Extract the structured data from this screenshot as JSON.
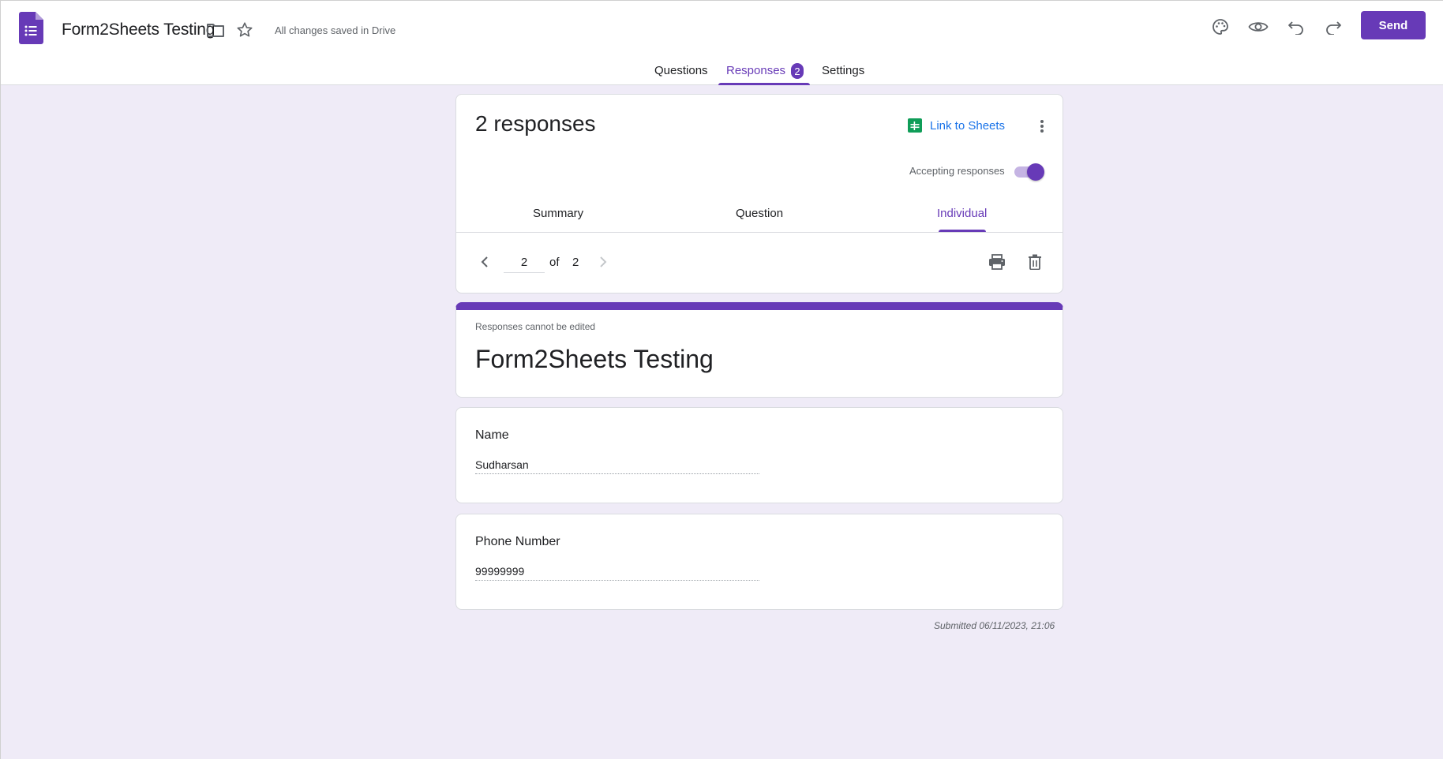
{
  "header": {
    "doc_title": "Form2Sheets Testing",
    "save_status": "All changes saved in Drive",
    "send_label": "Send",
    "icons": [
      "forms-logo-icon",
      "folder-icon",
      "star-icon",
      "palette-icon",
      "preview-eye-icon",
      "undo-icon",
      "redo-icon"
    ]
  },
  "tabs": {
    "questions": "Questions",
    "responses": "Responses",
    "responses_count": "2",
    "settings": "Settings",
    "active": "Responses"
  },
  "summary": {
    "responses_count": "2 responses",
    "link_to_sheets": "Link to Sheets",
    "accepting_label": "Accepting responses",
    "accepting": true,
    "sub_tabs": {
      "summary": "Summary",
      "question": "Question",
      "individual": "Individual",
      "active": "Individual"
    },
    "pager": {
      "current": "2",
      "of": "of",
      "total": "2"
    }
  },
  "response": {
    "edit_note": "Responses cannot be edited",
    "form_title": "Form2Sheets Testing",
    "questions": [
      {
        "label": "Name",
        "answer": "Sudharsan"
      },
      {
        "label": "Phone Number",
        "answer": "99999999"
      }
    ],
    "submitted": "Submitted 06/11/2023, 21:06"
  },
  "colors": {
    "accent": "#673ab7",
    "link": "#1a73e8",
    "sheets_green": "#0f9d58",
    "background": "#efebf7"
  }
}
